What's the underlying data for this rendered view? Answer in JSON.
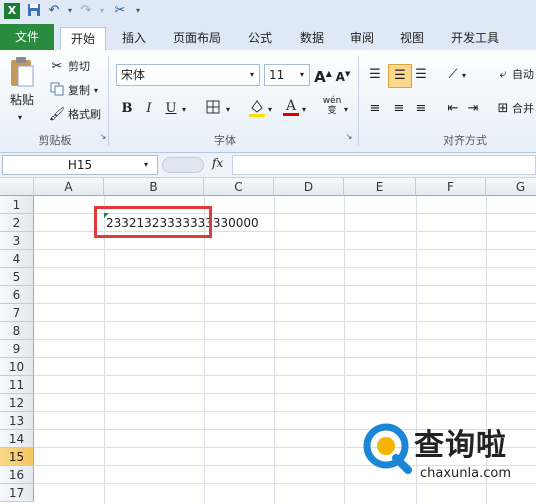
{
  "quick_access": {
    "excel_icon": "excel-icon",
    "save_icon": "save-icon",
    "undo_icon": "undo-icon",
    "redo_icon": "redo-icon",
    "customize_icon": "tools-icon"
  },
  "tabs": [
    {
      "label": "文件"
    },
    {
      "label": "开始"
    },
    {
      "label": "插入"
    },
    {
      "label": "页面布局"
    },
    {
      "label": "公式"
    },
    {
      "label": "数据"
    },
    {
      "label": "审阅"
    },
    {
      "label": "视图"
    },
    {
      "label": "开发工具"
    }
  ],
  "ribbon": {
    "clipboard": {
      "paste": "粘贴",
      "cut": "剪切",
      "copy": "复制",
      "format_painter": "格式刷",
      "label": "剪贴板"
    },
    "font": {
      "name": "宋体",
      "size": "11",
      "grow": "A",
      "shrink": "A",
      "bold": "B",
      "italic": "I",
      "underline": "U",
      "label": "字体",
      "phonetic": "wén"
    },
    "alignment": {
      "wrap": "自动",
      "merge": "合并",
      "label": "对齐方式"
    }
  },
  "formula_bar": {
    "name_box": "H15",
    "fx": "fx",
    "formula": ""
  },
  "grid": {
    "columns": [
      "A",
      "B",
      "C",
      "D",
      "E",
      "F",
      "G"
    ],
    "rows": [
      "1",
      "2",
      "3",
      "4",
      "5",
      "6",
      "7",
      "8",
      "9",
      "10",
      "11",
      "12",
      "13",
      "14",
      "15",
      "16",
      "17"
    ],
    "active_row": "15",
    "cell_b2": "23321323333333330000"
  },
  "watermark": {
    "text": "查询啦",
    "url": "chaxunla.com"
  },
  "colors": {
    "file_tab": "#2a8a3e",
    "highlight_box": "#e03a3a",
    "active_row": "#f4c560"
  }
}
